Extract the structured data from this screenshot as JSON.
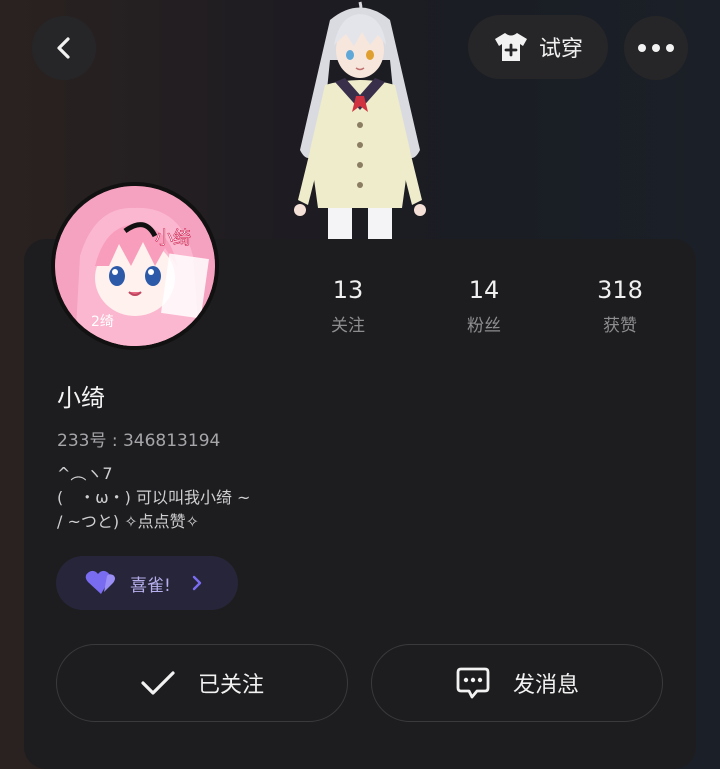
{
  "header": {
    "try_on_label": "试穿"
  },
  "stats": [
    {
      "value": "13",
      "label": "关注"
    },
    {
      "value": "14",
      "label": "粉丝"
    },
    {
      "value": "318",
      "label": "获赞"
    }
  ],
  "profile": {
    "name": "小绮",
    "uid": "233号 : 346813194",
    "bio": "^︵ヽ7\n(　・ω・) 可以叫我小绮 ~\n/ ~つと) ✧点点赞✧",
    "avatar_text": "小绮"
  },
  "tag": {
    "label": "喜雀!"
  },
  "actions": {
    "follow_label": "已关注",
    "message_label": "发消息"
  },
  "colors": {
    "accent": "#7a6cf0",
    "card": "#1d1d1f"
  }
}
